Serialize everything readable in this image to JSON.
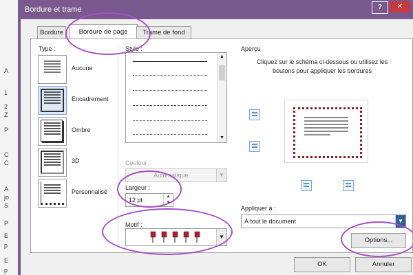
{
  "background_doc": {
    "letters": [
      "A",
      "1",
      "2",
      "Z",
      "P",
      "C",
      "C",
      "A",
      "jo",
      "S",
      "P",
      "E",
      "p",
      "E",
      "p"
    ]
  },
  "window": {
    "title": "Bordure et trame",
    "help_label": "?",
    "close_label": "✕"
  },
  "tabs": [
    {
      "label": "Bordure"
    },
    {
      "label": "Bordure de page"
    },
    {
      "label": "Trame de fond"
    }
  ],
  "type_section": {
    "label": "Type :",
    "items": [
      {
        "label": "Aucune"
      },
      {
        "label": "Encadrement"
      },
      {
        "label": "Ombre"
      },
      {
        "label": "3D"
      },
      {
        "label": "Personnalisé"
      }
    ]
  },
  "style_section": {
    "label": "Style :"
  },
  "color_section": {
    "label": "Couleur :",
    "value": "Automatique"
  },
  "width_section": {
    "label": "Largeur :",
    "value": "12 pt"
  },
  "motif_section": {
    "label": "Motif :"
  },
  "preview_section": {
    "label": "Aperçu",
    "instructions": "Cliquez sur le schéma ci-dessous ou utilisez les boutons pour appliquer les bordures"
  },
  "apply_section": {
    "label": "Appliquer à :",
    "value": "À tout le document"
  },
  "buttons": {
    "options": "Options...",
    "ok": "OK",
    "cancel": "Annuler"
  },
  "colors": {
    "title_bar": "#7a5a8e",
    "annotation_ring": "#a64ec6",
    "motif_red": "#c0182a"
  },
  "icons": [
    "help-icon",
    "close-icon",
    "chevron-down-icon",
    "spinner-up-icon",
    "spinner-down-icon",
    "border-top-icon",
    "border-bottom-icon",
    "border-left-icon",
    "border-right-icon"
  ]
}
